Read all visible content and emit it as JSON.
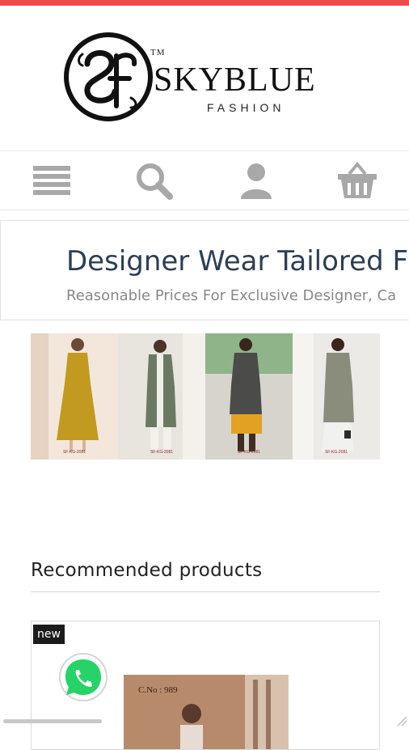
{
  "header": {
    "logo_monogram": "SF",
    "logo_tm": "TM",
    "logo_brand": "SKYBLUE",
    "logo_sub": "FASHION"
  },
  "nav": {
    "items": [
      {
        "icon": "menu-icon"
      },
      {
        "icon": "search-icon"
      },
      {
        "icon": "user-icon"
      },
      {
        "icon": "cart-icon"
      }
    ]
  },
  "banner": {
    "title": "Designer Wear Tailored F",
    "subtitle": "Reasonable Prices For Exclusive Designer, Ca"
  },
  "promo": {
    "codes": [
      "SF-KG-2081",
      "SF-KG-2081",
      "SF-KG-2081",
      "SF-KG-2081"
    ]
  },
  "recommended": {
    "title": "Recommended products",
    "products": [
      {
        "badge": "new",
        "code": "C.No : 989"
      }
    ]
  },
  "colors": {
    "accent": "#ef4b4b",
    "nav_icon": "#a8a8a8",
    "banner_title": "#2c3e55",
    "whatsapp": "#25d366"
  }
}
